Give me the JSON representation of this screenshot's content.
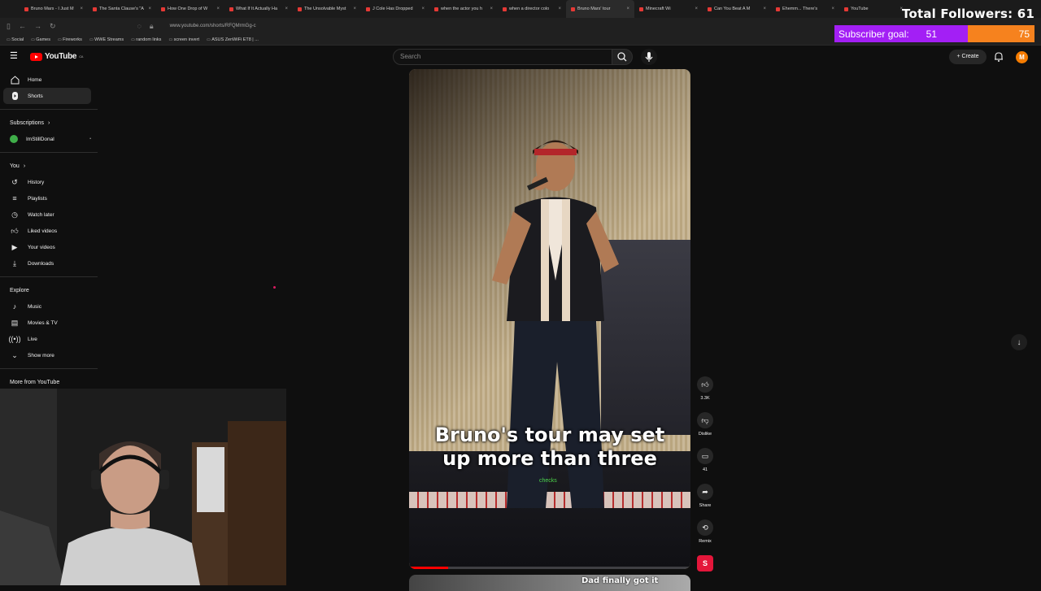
{
  "browser": {
    "tabs": [
      {
        "title": "Bruno Mars - I Just M"
      },
      {
        "title": "The Santa Clause's \"A"
      },
      {
        "title": "How One Drop of W"
      },
      {
        "title": "What If It Actually Ha"
      },
      {
        "title": "The Unsolvable Myst"
      },
      {
        "title": "J Cole Has Dropped"
      },
      {
        "title": "when the actor you h"
      },
      {
        "title": "when a director colo"
      },
      {
        "title": "Bruno Mars' tour"
      },
      {
        "title": "Minecraft Wi"
      },
      {
        "title": "Can You Beat A M"
      },
      {
        "title": "Ehemm... There's"
      },
      {
        "title": "YouTube"
      }
    ],
    "active_tab_index": 8,
    "url": "www.youtube.com/shorts/RFQMrmGg-c",
    "bookmarks": [
      "Social",
      "Games",
      "Fireworks",
      "WWE Streams",
      "random links",
      "screen invert",
      "ASUS ZenWiFi ET8 | ..."
    ]
  },
  "stream_overlay": {
    "total_followers": "Total Followers: 61",
    "subscriber_goal_label": "Subscriber goal:",
    "subscriber_current": "51",
    "subscriber_target": "75",
    "progress_fraction": 0.68,
    "fill_color": "#a31ff5",
    "rest_color": "#f6821e"
  },
  "youtube": {
    "logo_text": "YouTube",
    "logo_region": "CA",
    "search_placeholder": "Search",
    "create_label": "Create",
    "avatar_letter": "M",
    "sidebar": {
      "main": [
        {
          "label": "Home",
          "icon": "home-icon"
        },
        {
          "label": "Shorts",
          "icon": "shorts-icon"
        }
      ],
      "subscriptions_title": "Subscriptions",
      "subscriptions": [
        {
          "label": "ImStillDonal"
        }
      ],
      "you_title": "You",
      "you_items": [
        {
          "label": "History",
          "icon": "history-icon"
        },
        {
          "label": "Playlists",
          "icon": "playlists-icon"
        },
        {
          "label": "Watch later",
          "icon": "clock-icon"
        },
        {
          "label": "Liked videos",
          "icon": "thumbs-up-icon"
        },
        {
          "label": "Your videos",
          "icon": "play-icon"
        },
        {
          "label": "Downloads",
          "icon": "download-icon"
        }
      ],
      "explore_title": "Explore",
      "explore_items": [
        {
          "label": "Music",
          "icon": "music-icon"
        },
        {
          "label": "Movies & TV",
          "icon": "film-icon"
        },
        {
          "label": "Live",
          "icon": "live-icon"
        },
        {
          "label": "Show more",
          "icon": "chevron-down-icon"
        }
      ],
      "more_title": "More from YouTube"
    },
    "short": {
      "caption_line1": "Bruno's tour may set",
      "caption_line2": "up more than three",
      "caption_small": "checks",
      "progress_fraction": 0.14,
      "next_caption": "Dad finally got it"
    },
    "actions": [
      {
        "label": "3.3K",
        "icon": "thumbs-up-icon"
      },
      {
        "label": "Dislike",
        "icon": "thumbs-down-icon"
      },
      {
        "label": "41",
        "icon": "comment-icon"
      },
      {
        "label": "Share",
        "icon": "share-icon"
      },
      {
        "label": "Remix",
        "icon": "remix-icon"
      }
    ],
    "channel_letter": "S"
  }
}
